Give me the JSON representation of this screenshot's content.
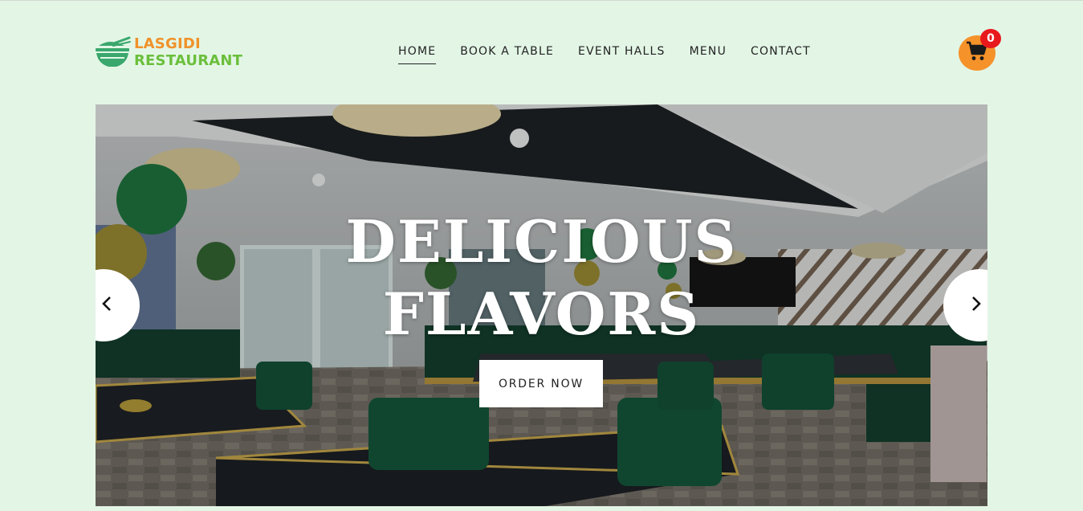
{
  "brand": {
    "line1": "LASGIDI",
    "line2": "RESTAURANT",
    "icon": "rice-bowl-icon",
    "colors": {
      "orange": "#f0922a",
      "green": "#6bbf3c"
    }
  },
  "nav": {
    "items": [
      {
        "label": "HOME",
        "active": true
      },
      {
        "label": "BOOK A TABLE",
        "active": false
      },
      {
        "label": "EVENT HALLS",
        "active": false
      },
      {
        "label": "MENU",
        "active": false
      },
      {
        "label": "CONTACT",
        "active": false
      }
    ]
  },
  "cart": {
    "icon": "shopping-cart-icon",
    "count": "0",
    "colors": {
      "button": "#f5922a",
      "badge": "#e8191c"
    }
  },
  "hero": {
    "title_line1": "DELICIOUS",
    "title_line2": "FLAVORS",
    "cta_label": "ORDER NOW",
    "prev_icon": "chevron-left-icon",
    "next_icon": "chevron-right-icon",
    "image": "restaurant-interior-photo"
  },
  "theme": {
    "background": "#e3f6e6"
  }
}
